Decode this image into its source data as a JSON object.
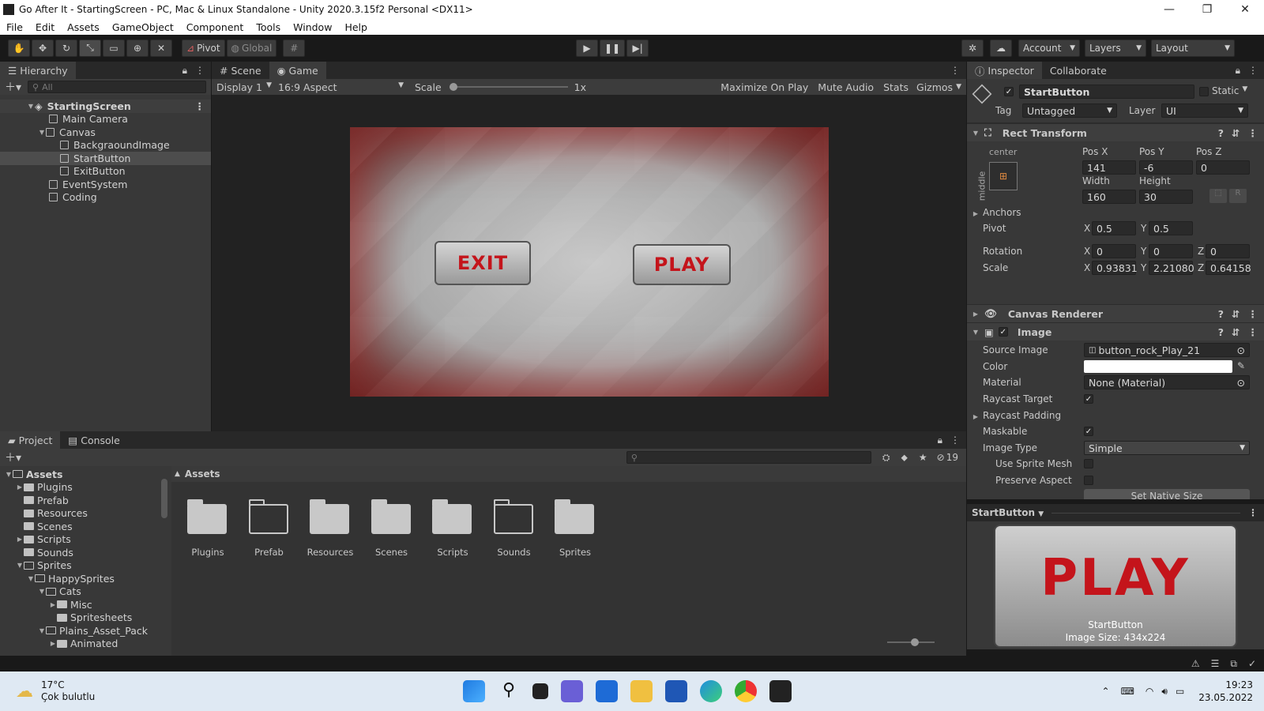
{
  "window": {
    "title": "Go After It - StartingScreen - PC, Mac & Linux Standalone - Unity 2020.3.15f2 Personal <DX11>",
    "minimize": "—",
    "maximize": "❐",
    "close": "✕"
  },
  "menu": [
    "File",
    "Edit",
    "Assets",
    "GameObject",
    "Component",
    "Tools",
    "Window",
    "Help"
  ],
  "toolbar": {
    "pivot": "Pivot",
    "global": "Global",
    "account": "Account",
    "layers": "Layers",
    "layout": "Layout"
  },
  "hierarchy": {
    "tab": "Hierarchy",
    "search_placeholder": "All",
    "scene": "StartingScreen",
    "items": [
      "Main Camera",
      "Canvas",
      "BackgraoundImage",
      "StartButton",
      "ExitButton",
      "EventSystem",
      "Coding"
    ]
  },
  "game_view": {
    "tab_scene": "Scene",
    "tab_game": "Game",
    "display": "Display 1",
    "aspect": "16:9 Aspect",
    "scale_label": "Scale",
    "scale_value": "1x",
    "maximize": "Maximize On Play",
    "mute": "Mute Audio",
    "stats": "Stats",
    "gizmos": "Gizmos",
    "exit_label": "EXIT",
    "play_label": "PLAY"
  },
  "inspector": {
    "tab": "Inspector",
    "tab2": "Collaborate",
    "object_name": "StartButton",
    "static": "Static",
    "tag_label": "Tag",
    "tag_value": "Untagged",
    "layer_label": "Layer",
    "layer_value": "UI",
    "rect_transform": "Rect Transform",
    "anchor_h": "center",
    "anchor_v": "middle",
    "posx_label": "Pos X",
    "posy_label": "Pos Y",
    "posz_label": "Pos Z",
    "posx": "141",
    "posy": "-6",
    "posz": "0",
    "width_label": "Width",
    "height_label": "Height",
    "width": "160",
    "height": "30",
    "anchors": "Anchors",
    "pivot": "Pivot",
    "pivot_x": "0.5",
    "pivot_y": "0.5",
    "rotation": "Rotation",
    "rot_x": "0",
    "rot_y": "0",
    "rot_z": "0",
    "scale": "Scale",
    "scale_x": "0.93831",
    "scale_y": "2.21080",
    "scale_z": "0.64158",
    "canvas_renderer": "Canvas Renderer",
    "image": "Image",
    "source_image_label": "Source Image",
    "source_image": "button_rock_Play_21",
    "color_label": "Color",
    "material_label": "Material",
    "material": "None (Material)",
    "raycast_target": "Raycast Target",
    "raycast_padding": "Raycast Padding",
    "maskable": "Maskable",
    "image_type_label": "Image Type",
    "image_type": "Simple",
    "use_sprite_mesh": "Use Sprite Mesh",
    "preserve_aspect": "Preserve Aspect",
    "set_native_size": "Set Native Size",
    "preview_title": "StartButton",
    "preview_name": "StartButton",
    "preview_size": "Image Size: 434x224",
    "preview_text": "PLAY"
  },
  "project": {
    "tab": "Project",
    "tab2": "Console",
    "count": "19",
    "breadcrumb": "Assets",
    "tree": [
      {
        "label": "Assets",
        "indent": 0,
        "open": true,
        "arrow": "▼"
      },
      {
        "label": "Plugins",
        "indent": 1,
        "open": false,
        "arrow": "▶"
      },
      {
        "label": "Prefab",
        "indent": 1,
        "open": false,
        "arrow": ""
      },
      {
        "label": "Resources",
        "indent": 1,
        "open": false,
        "arrow": ""
      },
      {
        "label": "Scenes",
        "indent": 1,
        "open": false,
        "arrow": ""
      },
      {
        "label": "Scripts",
        "indent": 1,
        "open": false,
        "arrow": "▶"
      },
      {
        "label": "Sounds",
        "indent": 1,
        "open": false,
        "arrow": ""
      },
      {
        "label": "Sprites",
        "indent": 1,
        "open": true,
        "arrow": "▼"
      },
      {
        "label": "HappySprites",
        "indent": 2,
        "open": true,
        "arrow": "▼"
      },
      {
        "label": "Cats",
        "indent": 3,
        "open": true,
        "arrow": "▼"
      },
      {
        "label": "Misc",
        "indent": 4,
        "open": false,
        "arrow": "▶"
      },
      {
        "label": "Spritesheets",
        "indent": 4,
        "open": false,
        "arrow": ""
      },
      {
        "label": "Plains_Asset_Pack",
        "indent": 3,
        "open": true,
        "arrow": "▼"
      },
      {
        "label": "Animated",
        "indent": 4,
        "open": false,
        "arrow": "▶"
      }
    ],
    "folders": [
      "Plugins",
      "Prefab",
      "Resources",
      "Scenes",
      "Scripts",
      "Sounds",
      "Sprites"
    ]
  },
  "taskbar": {
    "temp": "17°C",
    "weather": "Çok bulutlu",
    "time": "19:23",
    "date": "23.05.2022"
  }
}
